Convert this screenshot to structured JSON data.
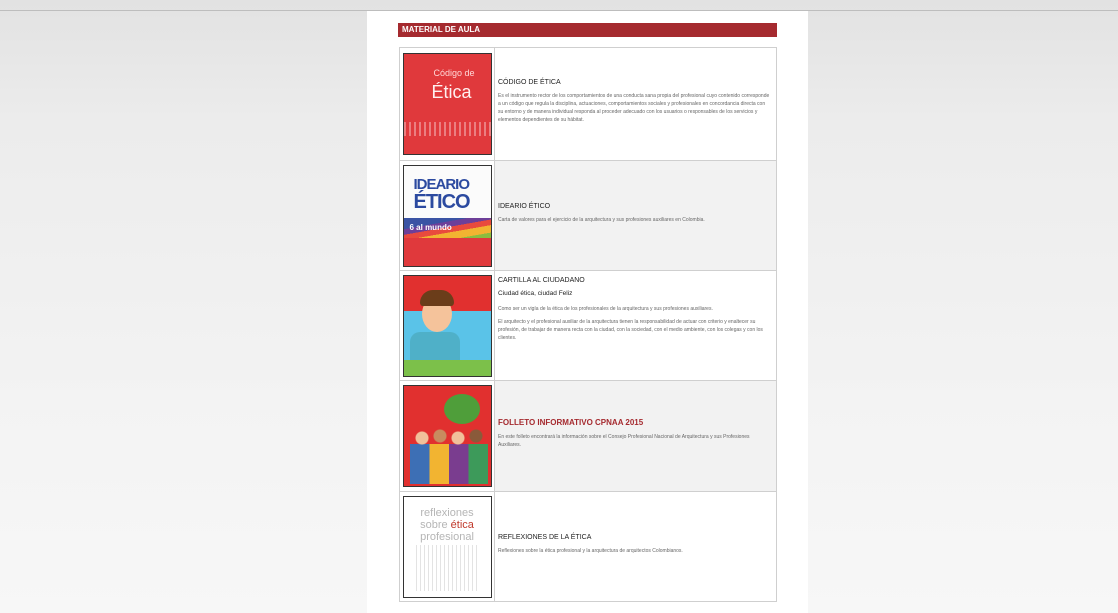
{
  "section": {
    "title": "MATERIAL DE AULA"
  },
  "items": [
    {
      "cover": {
        "line1": "Código de",
        "line2": "Ética"
      },
      "title": "CÓDIGO DE ÉTICA",
      "subtitle": "",
      "paragraphs": [
        "Es el instrumento rector de los comportamientos de una conducta sana propia del profesional cuyo contenido corresponde a un código que regula la disciplina, actuaciones, comportamientos sociales y profesionales en concordancia directa con su entorno y de manera individual responda al proceder adecuado con los usuarios o responsables de los servicios y elementos dependientes de su hábitat."
      ]
    },
    {
      "cover": {
        "line1": "IDEARIO",
        "line2": "ÉTICO",
        "line3": "6 al mundo"
      },
      "title": "IDEARIO ÉTICO",
      "subtitle": "",
      "paragraphs": [
        "Carta de valores para el ejercicio de la arquitectura y sus profesiones auxiliares en Colombia."
      ]
    },
    {
      "title": "CARTILLA AL CIUDADANO",
      "subtitle": "Ciudad ética, ciudad Feliz",
      "paragraphs": [
        "Como ser un vigía de la ética de los profesionales de la arquitectura y sus profesiones auxiliares.",
        "El arquitecto y el profesional auxiliar de la arquitectura tienen la responsabilidad de actuar con criterio y enaltecer su profesión, de trabajar de manera recta con la ciudad, con la sociedad, con el medio ambiente, con los colegas y con los clientes."
      ]
    },
    {
      "title": "FOLLETO INFORMATIVO CPNAA 2015",
      "subtitle": "",
      "paragraphs": [
        "En este folleto encontrará la información sobre el Consejo Profesional Nacional de Arquitectura y sus Profesiones Auxiliares."
      ]
    },
    {
      "cover": {
        "line1": "reflexiones",
        "line2a": "sobre ",
        "line2b": "ética",
        "line3": "profesional"
      },
      "title": "REFLEXIONES DE LA ÉTICA",
      "subtitle": "",
      "paragraphs": [
        "Reflexiones sobre la ética profesional y la arquitectura de arquitectos Colombianos."
      ]
    }
  ],
  "colors": {
    "accent": "#a52a2f",
    "cover_red": "#e0393c"
  }
}
